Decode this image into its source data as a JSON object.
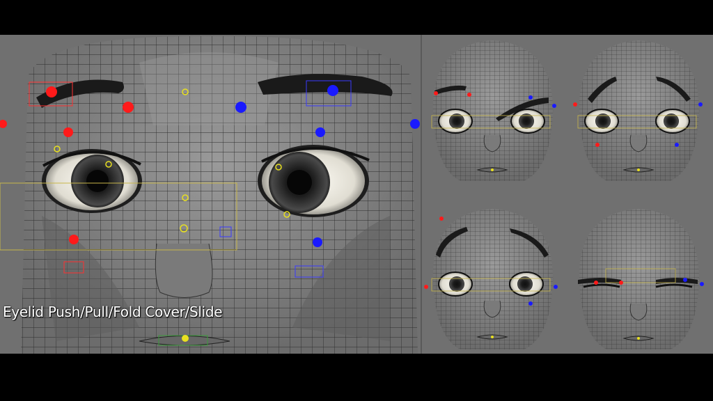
{
  "caption": "Eyelid Push/Pull/Fold Cover/Slide",
  "colors": {
    "background": "#707070",
    "mesh_fill": "#8a8a8a",
    "mesh_shade": "#6e6e6e",
    "wire": "#2b2b2b",
    "control_red": "#ff1a1a",
    "control_blue": "#1a1aff",
    "control_yellow": "#e8e020",
    "brow": "#1a1a1a",
    "sclera": "#f2efe6"
  },
  "views": [
    {
      "name": "main-closeup-view",
      "expression": "neutral"
    },
    {
      "name": "brow-raise-view",
      "expression": "left-brow-down"
    },
    {
      "name": "worried-brow-view",
      "expression": "worried"
    },
    {
      "name": "brow-arch-view",
      "expression": "arched"
    },
    {
      "name": "eyes-closed-view",
      "expression": "lids-closed"
    }
  ]
}
